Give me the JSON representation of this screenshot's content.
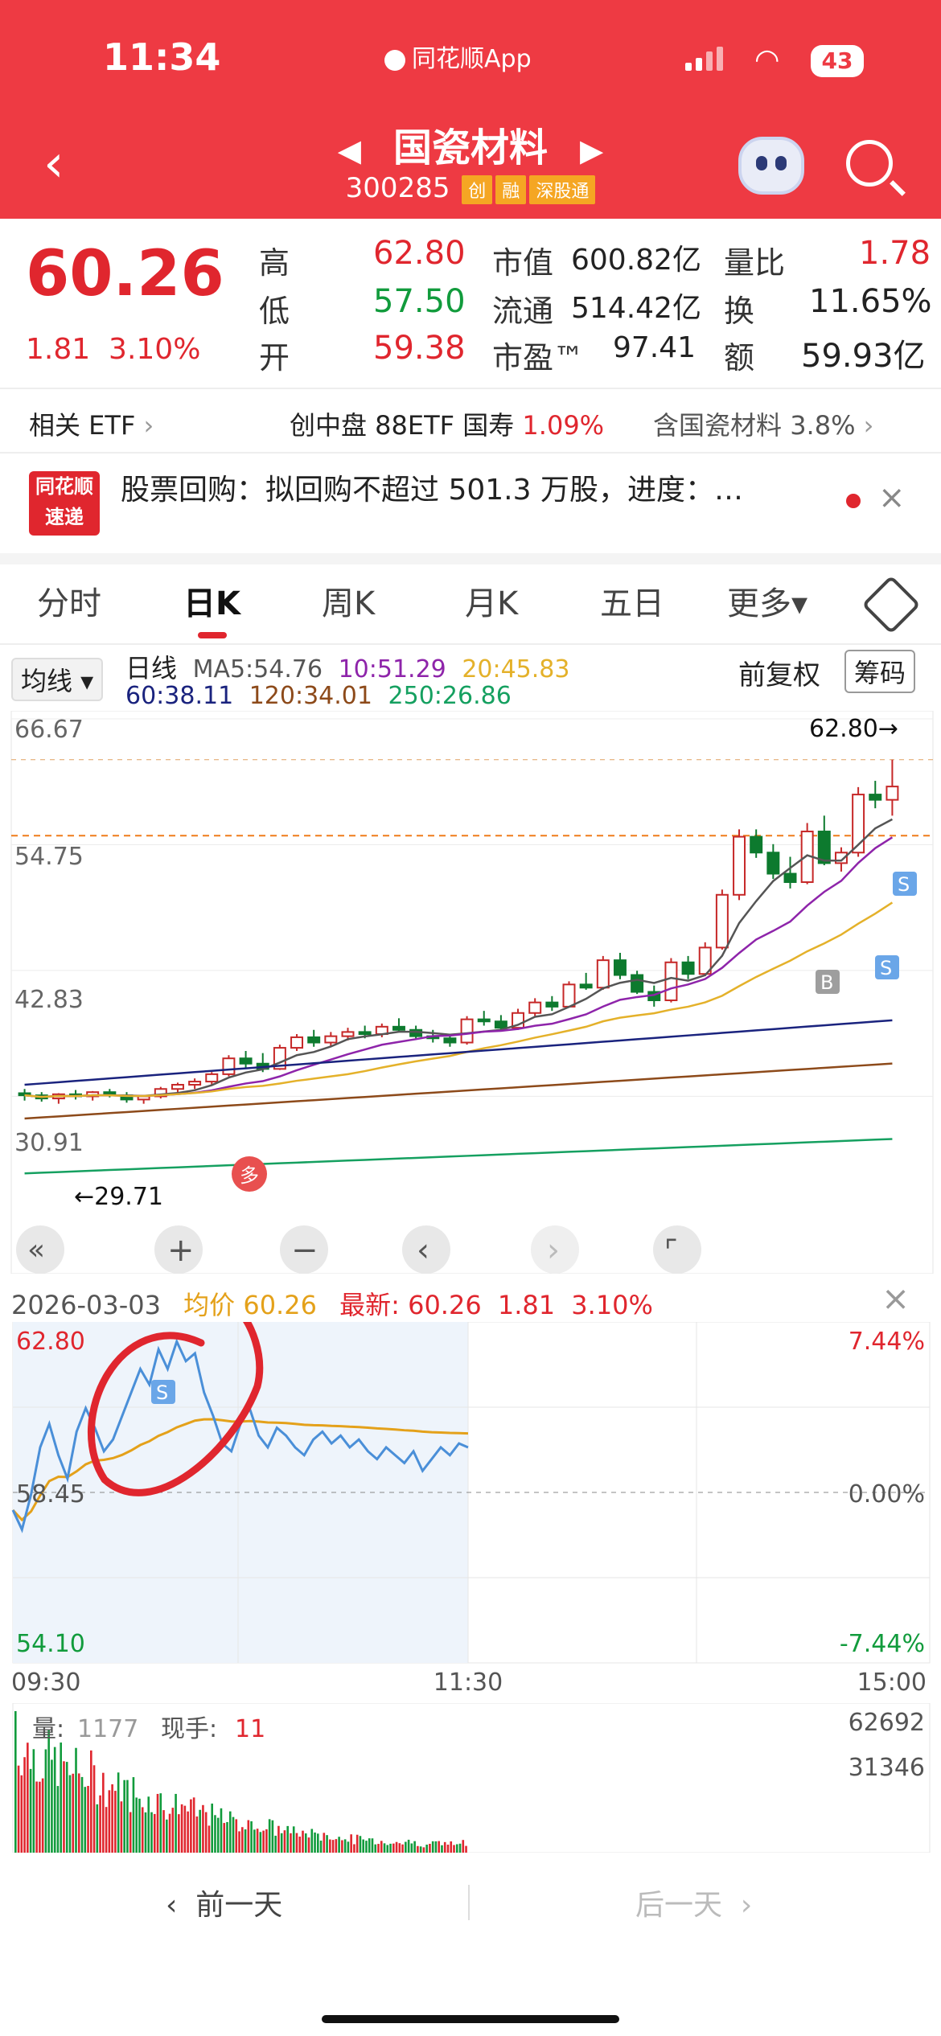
{
  "status_bar": {
    "time": "11:34",
    "app_name": "同花顺App",
    "battery": "43"
  },
  "header": {
    "title": "国瓷材料",
    "code": "300285",
    "tags": [
      "创",
      "融",
      "深股通"
    ]
  },
  "quote": {
    "price": "60.26",
    "change": "1.81",
    "change_pct": "3.10%",
    "labels": {
      "high": "高",
      "low": "低",
      "open": "开",
      "mcap": "市值",
      "float": "流通",
      "pe": "市盈™",
      "vol_ratio": "量比",
      "turnover": "换",
      "amount": "额"
    },
    "values": {
      "high": "62.80",
      "low": "57.50",
      "open": "59.38",
      "mcap": "600.82亿",
      "float": "514.42亿",
      "pe": "97.41",
      "vol_ratio": "1.78",
      "turnover": "11.65%",
      "amount": "59.93亿"
    }
  },
  "etf": {
    "label": "相关 ETF",
    "name": "创中盘 88ETF 国寿",
    "pct": "1.09%",
    "holding": "含国瓷材料",
    "holding_pct": "3.8%"
  },
  "news": {
    "logo_top": "同花顺",
    "logo_bottom": "速递",
    "text": "股票回购：拟回购不超过 501.3 万股，进度：…"
  },
  "tabs": [
    "分时",
    "日K",
    "周K",
    "月K",
    "五日",
    "更多▾"
  ],
  "active_tab": "日K",
  "ma_bar": {
    "selector": "均线 ▾",
    "line_type": "日线",
    "ma5": "MA5:54.76",
    "ma10": "10:51.29",
    "ma20": "20:45.83",
    "ma60": "60:38.11",
    "ma120": "120:34.01",
    "ma250": "250:26.86",
    "adjust": "前复权",
    "chips": "筹码"
  },
  "kline": {
    "y_labels": [
      "66.67",
      "54.75",
      "42.83",
      "30.91"
    ],
    "high_mark": "62.80→",
    "low_mark": "←29.71",
    "badge_duo": "多",
    "badge_b": "B",
    "badge_s": "S",
    "colors": {
      "up": "#c62828",
      "down": "#0d7a2e",
      "ma5": "#555555",
      "ma10": "#8e24aa",
      "ma20": "#e4b12a",
      "ma60": "#1a237e",
      "ma120": "#8d4a1a",
      "ma250": "#15a060"
    },
    "candles": [
      [
        31.2,
        31.6,
        30.5,
        31.0
      ],
      [
        31.0,
        31.3,
        30.4,
        30.7
      ],
      [
        30.7,
        31.2,
        30.2,
        31.1
      ],
      [
        31.1,
        31.5,
        30.6,
        30.9
      ],
      [
        30.9,
        31.4,
        30.5,
        31.3
      ],
      [
        31.3,
        31.6,
        30.8,
        31.0
      ],
      [
        31.0,
        31.3,
        30.3,
        30.6
      ],
      [
        30.6,
        31.0,
        30.2,
        30.9
      ],
      [
        30.9,
        31.8,
        30.7,
        31.6
      ],
      [
        31.6,
        32.2,
        31.2,
        32.0
      ],
      [
        32.0,
        32.6,
        31.6,
        32.3
      ],
      [
        32.3,
        33.2,
        32.0,
        33.0
      ],
      [
        33.0,
        34.8,
        32.8,
        34.5
      ],
      [
        34.5,
        35.2,
        33.6,
        34.0
      ],
      [
        34.0,
        35.0,
        33.2,
        33.5
      ],
      [
        33.5,
        35.8,
        33.4,
        35.5
      ],
      [
        35.5,
        36.8,
        35.2,
        36.5
      ],
      [
        36.5,
        37.2,
        35.6,
        36.0
      ],
      [
        36.0,
        37.0,
        35.6,
        36.6
      ],
      [
        36.6,
        37.4,
        36.2,
        37.0
      ],
      [
        37.0,
        37.6,
        36.4,
        36.8
      ],
      [
        36.8,
        37.8,
        36.5,
        37.5
      ],
      [
        37.5,
        38.3,
        37.0,
        37.2
      ],
      [
        37.2,
        37.6,
        36.3,
        36.6
      ],
      [
        36.6,
        37.2,
        36.0,
        36.4
      ],
      [
        36.4,
        36.8,
        35.6,
        36.0
      ],
      [
        36.0,
        38.5,
        35.8,
        38.2
      ],
      [
        38.2,
        39.0,
        37.6,
        38.0
      ],
      [
        38.0,
        38.6,
        37.2,
        37.4
      ],
      [
        37.4,
        39.2,
        37.2,
        38.8
      ],
      [
        38.8,
        40.2,
        38.4,
        39.8
      ],
      [
        39.8,
        40.4,
        39.0,
        39.4
      ],
      [
        39.4,
        41.8,
        39.3,
        41.5
      ],
      [
        41.5,
        42.6,
        41.0,
        41.2
      ],
      [
        41.2,
        44.2,
        41.0,
        43.8
      ],
      [
        43.8,
        44.5,
        42.0,
        42.4
      ],
      [
        42.4,
        42.8,
        40.6,
        40.8
      ],
      [
        40.8,
        41.4,
        39.4,
        40.0
      ],
      [
        40.0,
        44.0,
        39.8,
        43.6
      ],
      [
        43.6,
        44.2,
        42.0,
        42.5
      ],
      [
        42.5,
        45.5,
        42.3,
        45.0
      ],
      [
        45.0,
        50.5,
        44.8,
        50.0
      ],
      [
        50.0,
        56.2,
        49.5,
        55.5
      ],
      [
        55.5,
        56.2,
        53.5,
        54.0
      ],
      [
        54.0,
        54.8,
        51.5,
        52.0
      ],
      [
        52.0,
        53.6,
        50.6,
        51.2
      ],
      [
        51.2,
        56.8,
        51.0,
        56.0
      ],
      [
        56.0,
        57.5,
        52.8,
        53.0
      ],
      [
        53.0,
        54.5,
        52.2,
        54.0
      ],
      [
        54.0,
        60.2,
        53.6,
        59.5
      ],
      [
        59.5,
        60.8,
        58.2,
        59.0
      ],
      [
        59.0,
        62.8,
        57.5,
        60.26
      ]
    ]
  },
  "chart_toolbar": [
    "«",
    "+",
    "−",
    "‹",
    "›",
    "⌜"
  ],
  "intraday": {
    "date": "2026-03-03",
    "avg_label": "均价",
    "avg_value": "60.26",
    "latest_label": "最新:",
    "latest_value": "60.26",
    "latest_change": "1.81",
    "latest_pct": "3.10%",
    "y_left": [
      "62.80",
      "58.45",
      "54.10"
    ],
    "y_right": [
      "7.44%",
      "0.00%",
      "-7.44%"
    ],
    "time_labels": [
      "09:30",
      "11:30",
      "15:00"
    ],
    "badge_s": "S",
    "price": [
      58.0,
      57.5,
      58.4,
      59.6,
      60.2,
      59.4,
      58.8,
      60.0,
      60.6,
      60.1,
      59.5,
      59.8,
      60.4,
      61.0,
      61.6,
      61.2,
      62.1,
      61.6,
      62.3,
      61.8,
      62.0,
      61.0,
      60.4,
      59.7,
      59.5,
      60.2,
      60.6,
      59.9,
      59.6,
      60.1,
      59.9,
      59.6,
      59.4,
      59.8,
      60.0,
      59.7,
      59.9,
      59.6,
      59.8,
      59.5,
      59.3,
      59.6,
      59.4,
      59.2,
      59.5,
      59.0,
      59.3,
      59.6,
      59.4,
      59.7,
      59.6
    ]
  },
  "volume": {
    "label_vol": "量:",
    "vol": "1177",
    "label_hand": "现手:",
    "hand": "11",
    "y_top": "62692",
    "y_mid": "31346"
  },
  "footer": {
    "prev": "前一天",
    "next": "后一天"
  }
}
